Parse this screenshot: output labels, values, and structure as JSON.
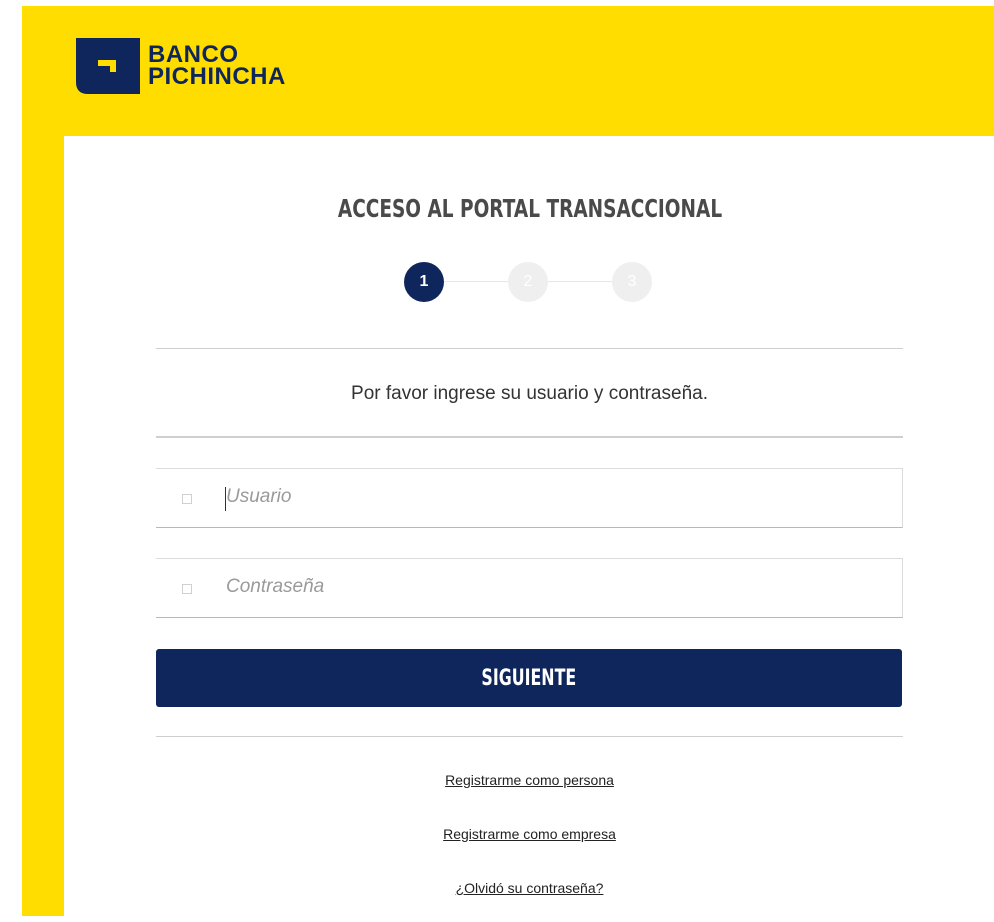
{
  "brand": {
    "line1": "BANCO",
    "line2": "PICHINCHA"
  },
  "page": {
    "title": "ACCESO AL PORTAL TRANSACCIONAL"
  },
  "steps": [
    {
      "label": "1",
      "state": "active"
    },
    {
      "label": "2",
      "state": "inactive"
    },
    {
      "label": "3",
      "state": "inactive"
    }
  ],
  "instruction": "Por favor ingrese su usuario y contraseña.",
  "form": {
    "username": {
      "placeholder": "Usuario",
      "value": ""
    },
    "password": {
      "placeholder": "Contraseña",
      "value": ""
    },
    "submit_label": "SIGUIENTE"
  },
  "links": {
    "register_person": "Registrarme como persona",
    "register_company": "Registrarme como empresa",
    "forgot_password": "¿Olvidó su contraseña?"
  },
  "colors": {
    "brand_yellow": "#ffdd00",
    "brand_navy": "#0f265c"
  }
}
